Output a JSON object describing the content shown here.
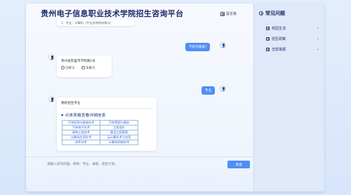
{
  "app": {
    "title": "贵州电子信息职业技术学院招生咨询平台",
    "guestbook_label": "留言板"
  },
  "messages": {
    "top_partial": "1、专业：计算机（专业咨询院校格式）",
    "user_q1": "学校在哪里?",
    "bot_a1": {
      "text": "贵州省凯里市学院路1号",
      "resolved": "已解决",
      "unresolved": "未解决"
    },
    "user_q2": "专业",
    "bot_a2": {
      "intro": "我校招生专业",
      "link_title": "点击表格查看详细信息",
      "majors": [
        [
          "汽车检测与维修技术",
          "汽车营销与服务"
        ],
        [
          "汽车电子技术",
          "工程造价"
        ],
        [
          "建筑工程技术",
          "建设工程管理"
        ],
        [
          "计算机应用技术",
          "云计算技术与应用"
        ],
        [
          "软件技术",
          "计算机网络技术"
        ]
      ]
    }
  },
  "input": {
    "placeholder": "请输入您的问题。例如：专业、录取、招生计划...",
    "send_label": "发送"
  },
  "sidebar": {
    "title": "常见问题",
    "categories": [
      {
        "label": "校园生活",
        "icon": "campus-icon"
      },
      {
        "label": "招生政策",
        "icon": "policy-icon"
      },
      {
        "label": "志愿填报",
        "icon": "application-icon"
      }
    ]
  },
  "colors": {
    "accent": "#4f8ef7",
    "title": "#1f2d6a",
    "link": "#2b66d9"
  }
}
